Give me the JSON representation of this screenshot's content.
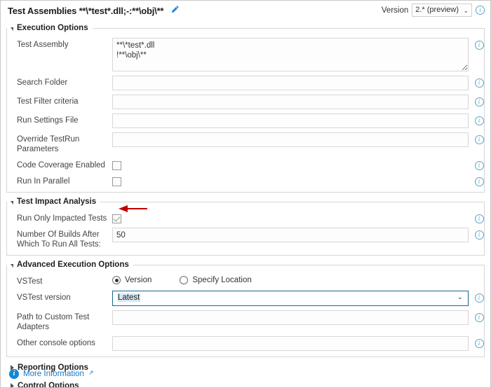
{
  "header": {
    "title": "Test Assemblies **\\*test*.dll;-:**\\obj\\**",
    "edit_icon": "pencil-icon",
    "version_label": "Version",
    "version_value": "2.* (preview)",
    "chevron": "⌄",
    "info_icon": "i"
  },
  "sections": [
    {
      "id": "execution-options",
      "title": "Execution Options",
      "expanded": true
    },
    {
      "id": "test-impact-analysis",
      "title": "Test Impact Analysis",
      "expanded": true
    },
    {
      "id": "advanced-execution-options",
      "title": "Advanced Execution Options",
      "expanded": true
    },
    {
      "id": "reporting-options",
      "title": "Reporting Options",
      "expanded": false
    },
    {
      "id": "control-options",
      "title": "Control Options",
      "expanded": false
    }
  ],
  "execution_options": {
    "test_assembly": {
      "label": "Test Assembly",
      "value": "**\\*test*.dll\n!**\\obj\\**",
      "placeholder": ""
    },
    "search_folder": {
      "label": "Search Folder",
      "value": "",
      "placeholder": ""
    },
    "test_filter_criteria": {
      "label": "Test Filter criteria",
      "value": "",
      "placeholder": ""
    },
    "run_settings_file": {
      "label": "Run Settings File",
      "value": "",
      "placeholder": ""
    },
    "override_testrun_parameters": {
      "label": "Override TestRun Parameters",
      "value": "",
      "placeholder": ""
    },
    "code_coverage_enabled": {
      "label": "Code Coverage Enabled",
      "checked": false
    },
    "run_in_parallel": {
      "label": "Run In Parallel",
      "checked": false
    }
  },
  "test_impact_analysis": {
    "run_only_impacted_tests": {
      "label": "Run Only Impacted Tests",
      "checked": true
    },
    "number_of_builds": {
      "label": "Number Of Builds After Which To Run All Tests:",
      "value": "50",
      "placeholder": ""
    },
    "annotation": {
      "type": "arrow",
      "color": "#c00000",
      "points_to": "run-only-impacted-tests-checkbox"
    }
  },
  "advanced_execution_options": {
    "vstest": {
      "label": "VSTest",
      "options": [
        "Version",
        "Specify Location"
      ],
      "selected": "Version"
    },
    "vstest_version": {
      "label": "VSTest version",
      "value": "Latest",
      "chevron": "⌄"
    },
    "path_to_custom_test_adapters": {
      "label": "Path to Custom Test Adapters",
      "value": "",
      "placeholder": ""
    },
    "other_console_options": {
      "label": "Other console options",
      "value": "",
      "placeholder": ""
    }
  },
  "footer": {
    "info_icon": "i",
    "more_information_label": "More Information",
    "external_link_icon": "↗"
  },
  "colors": {
    "accent_blue": "#1a76c4",
    "info_blue": "#5ba4c4",
    "focus_border": "#0e6a94",
    "annotation_red": "#c00000",
    "border_gray": "#d6d6d6"
  }
}
